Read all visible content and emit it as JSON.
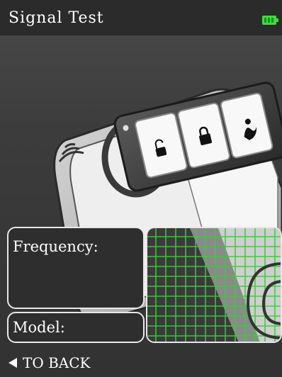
{
  "header": {
    "title": "Signal Test",
    "battery_icon": "battery-full-icon",
    "battery_color": "#3ae03a"
  },
  "illustration": {
    "key_fob_icons": [
      "unlock-icon",
      "lock-icon",
      "trunk-icon"
    ],
    "tester_icon": "wireless-signal-icon",
    "grid_color": "#30d030"
  },
  "panels": {
    "frequency_label": "Frequency:",
    "model_label": "Model:"
  },
  "footer": {
    "back_label": "TO BACK",
    "back_icon": "left-arrow-icon"
  }
}
